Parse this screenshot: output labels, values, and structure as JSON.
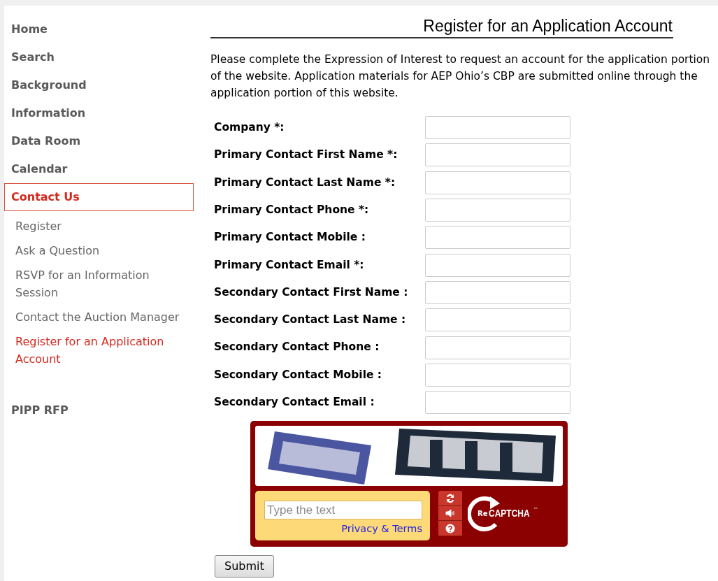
{
  "sidebar": {
    "items": [
      {
        "label": "Home",
        "selected": false
      },
      {
        "label": "Search",
        "selected": false
      },
      {
        "label": "Background",
        "selected": false
      },
      {
        "label": "Information",
        "selected": false
      },
      {
        "label": "Data Room",
        "selected": false
      },
      {
        "label": "Calendar",
        "selected": false
      },
      {
        "label": "Contact Us",
        "selected": true,
        "children": [
          {
            "label": "Register",
            "selected": false
          },
          {
            "label": "Ask a Question",
            "selected": false
          },
          {
            "label": "RSVP for an Information Session",
            "selected": false
          },
          {
            "label": "Contact the Auction Manager",
            "selected": false
          },
          {
            "label": "Register for an Application Account",
            "selected": true
          }
        ]
      },
      {
        "label": "PIPP RFP",
        "selected": false
      }
    ]
  },
  "page": {
    "title": "Register for an Application Account",
    "intro": "Please complete the Expression of Interest to request an account for the application portion of the website. Application materials for AEP Ohio’s CBP are submitted online through the application portion of this website."
  },
  "form": {
    "fields": [
      {
        "label": "Company *:"
      },
      {
        "label": "Primary Contact First Name *:"
      },
      {
        "label": "Primary Contact Last Name *:"
      },
      {
        "label": "Primary Contact Phone *:"
      },
      {
        "label": "Primary Contact Mobile :"
      },
      {
        "label": "Primary Contact Email *:"
      },
      {
        "label": "Secondary Contact First Name :"
      },
      {
        "label": "Secondary Contact Last Name :"
      },
      {
        "label": "Secondary Contact Phone :"
      },
      {
        "label": "Secondary Contact Mobile :"
      },
      {
        "label": "Secondary Contact Email :"
      }
    ],
    "captcha": {
      "placeholder": "Type the text",
      "link": "Privacy & Terms",
      "logo_prefix": "Re",
      "logo_text": "CAPTCHA",
      "logo_mark": "™"
    },
    "submit": "Submit"
  }
}
